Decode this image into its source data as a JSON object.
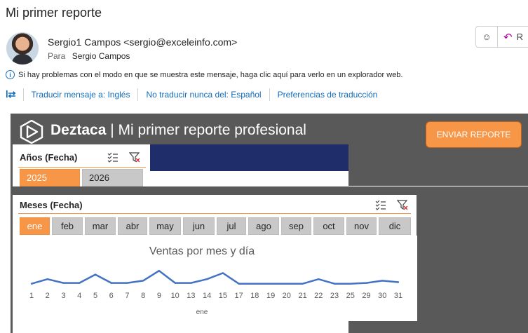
{
  "email": {
    "subject": "Mi primer reporte",
    "sender": "Sergio1 Campos <sergio@exceleinfo.com>",
    "to_label": "Para",
    "to_name": "Sergio Campos",
    "reply_label": "R",
    "info_message": "Si hay problemas con el modo en que se muestra este mensaje, haga clic aquí para verlo en un explorador web.",
    "translate_links": [
      "Traducir mensaje a: Inglés",
      "No traducir nunca del: Español",
      "Preferencias de traducción"
    ]
  },
  "report": {
    "brand": "Deztaca",
    "title_rest": " | Mi primer reporte profesional",
    "send_button": "ENVIAR REPORTE",
    "colors": {
      "accent": "#f79646",
      "navy": "#1f2d6a",
      "banner": "#595959",
      "line": "#4472c4"
    }
  },
  "slicers": {
    "years": {
      "title": "Años (Fecha)",
      "items": [
        {
          "label": "2025",
          "selected": true
        },
        {
          "label": "2026",
          "selected": false
        }
      ]
    },
    "months": {
      "title": "Meses (Fecha)",
      "items": [
        {
          "label": "ene",
          "selected": true
        },
        {
          "label": "feb",
          "selected": false
        },
        {
          "label": "mar",
          "selected": false
        },
        {
          "label": "abr",
          "selected": false
        },
        {
          "label": "may",
          "selected": false
        },
        {
          "label": "jun",
          "selected": false
        },
        {
          "label": "jul",
          "selected": false
        },
        {
          "label": "ago",
          "selected": false
        },
        {
          "label": "sep",
          "selected": false
        },
        {
          "label": "oct",
          "selected": false
        },
        {
          "label": "nov",
          "selected": false
        },
        {
          "label": "dic",
          "selected": false
        }
      ]
    }
  },
  "chart_data": {
    "type": "line",
    "title": "Ventas por mes y día",
    "categories": [
      "1",
      "2",
      "3",
      "4",
      "5",
      "6",
      "7",
      "8",
      "9",
      "10",
      "13",
      "14",
      "15",
      "17",
      "18",
      "19",
      "20",
      "21",
      "22",
      "23",
      "25",
      "29",
      "30",
      "31"
    ],
    "group_label": "ene",
    "series": [
      {
        "values": [
          3,
          9,
          4,
          4,
          15,
          4,
          4,
          7,
          20,
          4,
          4,
          9,
          17,
          3,
          3,
          3,
          3,
          3,
          9,
          3,
          3,
          4,
          7,
          5
        ]
      }
    ],
    "ylim": [
      0,
      22
    ],
    "grid": false,
    "legend": "none"
  }
}
